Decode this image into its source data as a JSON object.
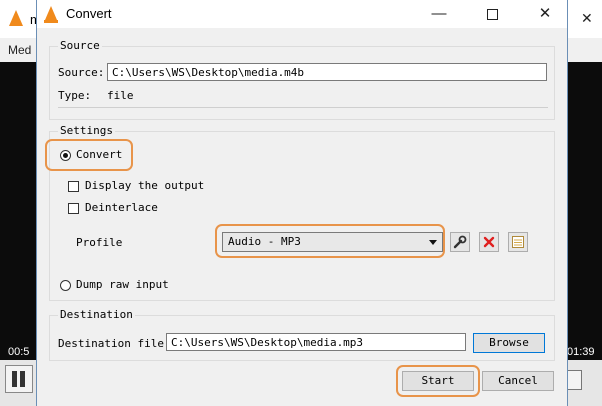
{
  "background_window": {
    "title": "m",
    "menu_text": "Med",
    "time_left": "00:5",
    "time_right": "01:39"
  },
  "dialog": {
    "title": "Convert",
    "buttons": {
      "minimize": "—",
      "close": "✕"
    }
  },
  "source": {
    "legend": "Source",
    "source_label": "Source:",
    "source_value": "C:\\Users\\WS\\Desktop\\media.m4b",
    "type_label": "Type:",
    "type_value": "file"
  },
  "settings": {
    "legend": "Settings",
    "convert_label": "Convert",
    "convert_checked": true,
    "display_output_label": "Display the output",
    "display_output_checked": false,
    "deinterlace_label": "Deinterlace",
    "deinterlace_checked": false,
    "profile_label": "Profile",
    "profile_value": "Audio - MP3",
    "dump_raw_label": "Dump raw input",
    "dump_raw_checked": false,
    "profile_buttons": [
      "wrench-icon",
      "delete-icon",
      "new-profile-icon"
    ]
  },
  "destination": {
    "legend": "Destination",
    "file_label": "Destination file:",
    "file_value": "C:\\Users\\WS\\Desktop\\media.mp3",
    "browse_label": "Browse"
  },
  "actions": {
    "start_label": "Start",
    "cancel_label": "Cancel"
  },
  "colors": {
    "highlight": "#e8944a",
    "vlc_orange": "#f08a1c",
    "delete_red": "#e02020"
  }
}
